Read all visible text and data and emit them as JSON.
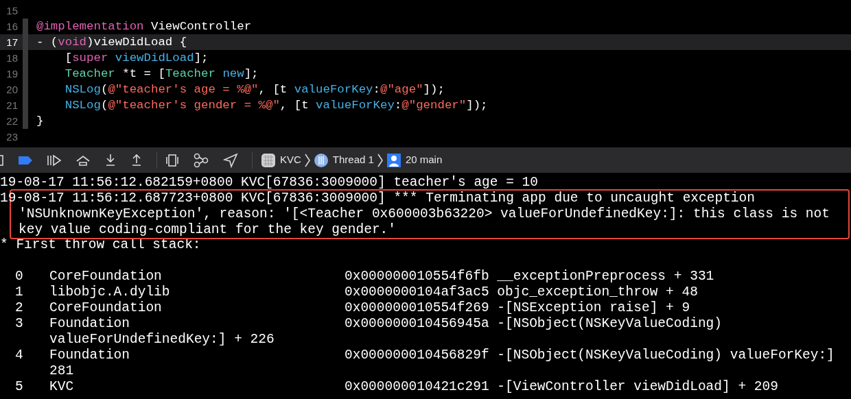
{
  "editor": {
    "lines": [
      {
        "number": "15",
        "current": false
      },
      {
        "number": "16",
        "current": false,
        "tokens": [
          {
            "kind": "keyword",
            "text": "@implementation"
          },
          {
            "kind": "plain",
            "text": " ViewController"
          }
        ]
      },
      {
        "number": "17",
        "current": true,
        "tokens": [
          {
            "kind": "plain",
            "text": "- ("
          },
          {
            "kind": "keyword",
            "text": "void"
          },
          {
            "kind": "plain",
            "text": ")viewDidLoad {"
          }
        ]
      },
      {
        "number": "18",
        "current": false,
        "tokens": [
          {
            "kind": "plain",
            "text": "    ["
          },
          {
            "kind": "keyword",
            "text": "super "
          },
          {
            "kind": "method",
            "text": "viewDidLoad"
          },
          {
            "kind": "plain",
            "text": "];"
          }
        ]
      },
      {
        "number": "19",
        "current": false,
        "tokens": [
          {
            "kind": "type",
            "text": "    Teacher"
          },
          {
            "kind": "plain",
            "text": " *t = ["
          },
          {
            "kind": "type",
            "text": "Teacher "
          },
          {
            "kind": "method",
            "text": "new"
          },
          {
            "kind": "plain",
            "text": "];"
          }
        ]
      },
      {
        "number": "20",
        "current": false,
        "tokens": [
          {
            "kind": "method",
            "text": "    NSLog"
          },
          {
            "kind": "plain",
            "text": "("
          },
          {
            "kind": "string",
            "text": "@\"teacher's age = %@\""
          },
          {
            "kind": "plain",
            "text": ", [t "
          },
          {
            "kind": "method",
            "text": "valueForKey"
          },
          {
            "kind": "plain",
            "text": ":"
          },
          {
            "kind": "string",
            "text": "@\"age\""
          },
          {
            "kind": "plain",
            "text": "]);"
          }
        ]
      },
      {
        "number": "21",
        "current": false,
        "tokens": [
          {
            "kind": "method",
            "text": "    NSLog"
          },
          {
            "kind": "plain",
            "text": "("
          },
          {
            "kind": "string",
            "text": "@\"teacher's gender = %@\""
          },
          {
            "kind": "plain",
            "text": ", [t "
          },
          {
            "kind": "method",
            "text": "valueForKey"
          },
          {
            "kind": "plain",
            "text": ":"
          },
          {
            "kind": "string",
            "text": "@\"gender\""
          },
          {
            "kind": "plain",
            "text": "]);"
          }
        ]
      },
      {
        "number": "22",
        "current": false,
        "tokens": [
          {
            "kind": "plain",
            "text": "}"
          }
        ]
      },
      {
        "number": "23",
        "current": false
      }
    ]
  },
  "debug_bar": {
    "breakpoints_active": true,
    "breadcrumbs": [
      {
        "kind": "app",
        "label": "KVC"
      },
      {
        "kind": "thread",
        "label": "Thread 1"
      },
      {
        "kind": "frame",
        "label": "20 main"
      }
    ]
  },
  "console": {
    "log_line": "19-08-17 11:56:12.682159+0800 KVC[67836:3009000] teacher's age = 10",
    "error_lines": [
      "19-08-17 11:56:12.687723+0800 KVC[67836:3009000] *** Terminating app due to uncaught exception",
      "'NSUnknownKeyException', reason: '[<Teacher 0x600003b63220> valueForUndefinedKey:]: this class is not",
      "key value coding-compliant for the key gender.'"
    ],
    "stack_title": "* First throw call stack:",
    "frames": [
      {
        "index": "0",
        "library": "CoreFoundation",
        "address": "0x000000010554f6fb",
        "symbol": "__exceptionPreprocess + 331"
      },
      {
        "index": "1",
        "library": "libobjc.A.dylib",
        "address": "0x0000000104af3ac5",
        "symbol": "objc_exception_throw + 48"
      },
      {
        "index": "2",
        "library": "CoreFoundation",
        "address": "0x000000010554f269",
        "symbol": "-[NSException raise] + 9"
      },
      {
        "index": "3",
        "library": "Foundation",
        "address": "0x000000010456945a",
        "symbol": "-[NSObject(NSKeyValueCoding)",
        "continuation": "valueForUndefinedKey:] + 226"
      },
      {
        "index": "4",
        "library": "Foundation",
        "address": "0x000000010456829f",
        "symbol": "-[NSObject(NSKeyValueCoding) valueForKey:]",
        "continuation": "281"
      },
      {
        "index": "5",
        "library": "KVC",
        "address": "0x000000010421c291",
        "symbol": "-[ViewController viewDidLoad] + 209"
      }
    ]
  }
}
